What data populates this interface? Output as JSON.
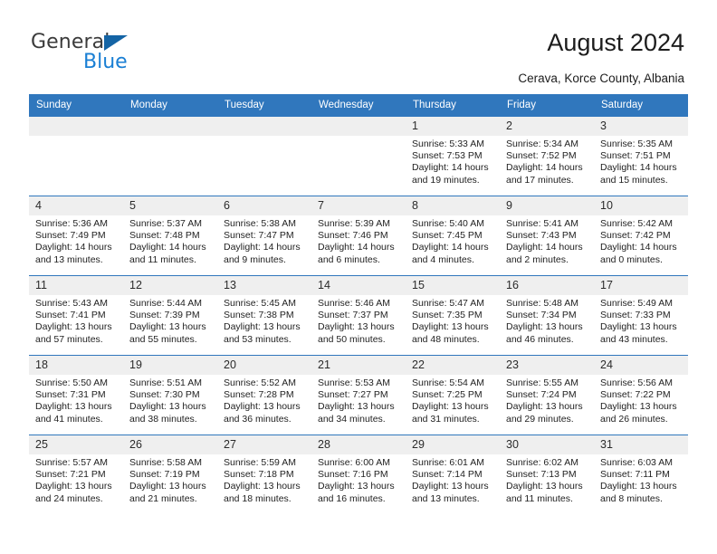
{
  "brand": {
    "name_primary": "General",
    "name_secondary": "Blue",
    "triangle_color": "#1464a5",
    "blue_color": "#1a7fd4"
  },
  "header": {
    "title": "August 2024",
    "subtitle": "Cerava, Korce County, Albania"
  },
  "theme": {
    "header_row_bg": "#3077bd",
    "daynum_bg": "#efefef",
    "row_border": "#3077bd"
  },
  "weekday_headers": [
    "Sunday",
    "Monday",
    "Tuesday",
    "Wednesday",
    "Thursday",
    "Friday",
    "Saturday"
  ],
  "weeks": [
    [
      {
        "day": "",
        "sunrise": "",
        "sunset": "",
        "daylight_line1": "",
        "daylight_line2": ""
      },
      {
        "day": "",
        "sunrise": "",
        "sunset": "",
        "daylight_line1": "",
        "daylight_line2": ""
      },
      {
        "day": "",
        "sunrise": "",
        "sunset": "",
        "daylight_line1": "",
        "daylight_line2": ""
      },
      {
        "day": "",
        "sunrise": "",
        "sunset": "",
        "daylight_line1": "",
        "daylight_line2": ""
      },
      {
        "day": "1",
        "sunrise": "Sunrise: 5:33 AM",
        "sunset": "Sunset: 7:53 PM",
        "daylight_line1": "Daylight: 14 hours",
        "daylight_line2": "and 19 minutes."
      },
      {
        "day": "2",
        "sunrise": "Sunrise: 5:34 AM",
        "sunset": "Sunset: 7:52 PM",
        "daylight_line1": "Daylight: 14 hours",
        "daylight_line2": "and 17 minutes."
      },
      {
        "day": "3",
        "sunrise": "Sunrise: 5:35 AM",
        "sunset": "Sunset: 7:51 PM",
        "daylight_line1": "Daylight: 14 hours",
        "daylight_line2": "and 15 minutes."
      }
    ],
    [
      {
        "day": "4",
        "sunrise": "Sunrise: 5:36 AM",
        "sunset": "Sunset: 7:49 PM",
        "daylight_line1": "Daylight: 14 hours",
        "daylight_line2": "and 13 minutes."
      },
      {
        "day": "5",
        "sunrise": "Sunrise: 5:37 AM",
        "sunset": "Sunset: 7:48 PM",
        "daylight_line1": "Daylight: 14 hours",
        "daylight_line2": "and 11 minutes."
      },
      {
        "day": "6",
        "sunrise": "Sunrise: 5:38 AM",
        "sunset": "Sunset: 7:47 PM",
        "daylight_line1": "Daylight: 14 hours",
        "daylight_line2": "and 9 minutes."
      },
      {
        "day": "7",
        "sunrise": "Sunrise: 5:39 AM",
        "sunset": "Sunset: 7:46 PM",
        "daylight_line1": "Daylight: 14 hours",
        "daylight_line2": "and 6 minutes."
      },
      {
        "day": "8",
        "sunrise": "Sunrise: 5:40 AM",
        "sunset": "Sunset: 7:45 PM",
        "daylight_line1": "Daylight: 14 hours",
        "daylight_line2": "and 4 minutes."
      },
      {
        "day": "9",
        "sunrise": "Sunrise: 5:41 AM",
        "sunset": "Sunset: 7:43 PM",
        "daylight_line1": "Daylight: 14 hours",
        "daylight_line2": "and 2 minutes."
      },
      {
        "day": "10",
        "sunrise": "Sunrise: 5:42 AM",
        "sunset": "Sunset: 7:42 PM",
        "daylight_line1": "Daylight: 14 hours",
        "daylight_line2": "and 0 minutes."
      }
    ],
    [
      {
        "day": "11",
        "sunrise": "Sunrise: 5:43 AM",
        "sunset": "Sunset: 7:41 PM",
        "daylight_line1": "Daylight: 13 hours",
        "daylight_line2": "and 57 minutes."
      },
      {
        "day": "12",
        "sunrise": "Sunrise: 5:44 AM",
        "sunset": "Sunset: 7:39 PM",
        "daylight_line1": "Daylight: 13 hours",
        "daylight_line2": "and 55 minutes."
      },
      {
        "day": "13",
        "sunrise": "Sunrise: 5:45 AM",
        "sunset": "Sunset: 7:38 PM",
        "daylight_line1": "Daylight: 13 hours",
        "daylight_line2": "and 53 minutes."
      },
      {
        "day": "14",
        "sunrise": "Sunrise: 5:46 AM",
        "sunset": "Sunset: 7:37 PM",
        "daylight_line1": "Daylight: 13 hours",
        "daylight_line2": "and 50 minutes."
      },
      {
        "day": "15",
        "sunrise": "Sunrise: 5:47 AM",
        "sunset": "Sunset: 7:35 PM",
        "daylight_line1": "Daylight: 13 hours",
        "daylight_line2": "and 48 minutes."
      },
      {
        "day": "16",
        "sunrise": "Sunrise: 5:48 AM",
        "sunset": "Sunset: 7:34 PM",
        "daylight_line1": "Daylight: 13 hours",
        "daylight_line2": "and 46 minutes."
      },
      {
        "day": "17",
        "sunrise": "Sunrise: 5:49 AM",
        "sunset": "Sunset: 7:33 PM",
        "daylight_line1": "Daylight: 13 hours",
        "daylight_line2": "and 43 minutes."
      }
    ],
    [
      {
        "day": "18",
        "sunrise": "Sunrise: 5:50 AM",
        "sunset": "Sunset: 7:31 PM",
        "daylight_line1": "Daylight: 13 hours",
        "daylight_line2": "and 41 minutes."
      },
      {
        "day": "19",
        "sunrise": "Sunrise: 5:51 AM",
        "sunset": "Sunset: 7:30 PM",
        "daylight_line1": "Daylight: 13 hours",
        "daylight_line2": "and 38 minutes."
      },
      {
        "day": "20",
        "sunrise": "Sunrise: 5:52 AM",
        "sunset": "Sunset: 7:28 PM",
        "daylight_line1": "Daylight: 13 hours",
        "daylight_line2": "and 36 minutes."
      },
      {
        "day": "21",
        "sunrise": "Sunrise: 5:53 AM",
        "sunset": "Sunset: 7:27 PM",
        "daylight_line1": "Daylight: 13 hours",
        "daylight_line2": "and 34 minutes."
      },
      {
        "day": "22",
        "sunrise": "Sunrise: 5:54 AM",
        "sunset": "Sunset: 7:25 PM",
        "daylight_line1": "Daylight: 13 hours",
        "daylight_line2": "and 31 minutes."
      },
      {
        "day": "23",
        "sunrise": "Sunrise: 5:55 AM",
        "sunset": "Sunset: 7:24 PM",
        "daylight_line1": "Daylight: 13 hours",
        "daylight_line2": "and 29 minutes."
      },
      {
        "day": "24",
        "sunrise": "Sunrise: 5:56 AM",
        "sunset": "Sunset: 7:22 PM",
        "daylight_line1": "Daylight: 13 hours",
        "daylight_line2": "and 26 minutes."
      }
    ],
    [
      {
        "day": "25",
        "sunrise": "Sunrise: 5:57 AM",
        "sunset": "Sunset: 7:21 PM",
        "daylight_line1": "Daylight: 13 hours",
        "daylight_line2": "and 24 minutes."
      },
      {
        "day": "26",
        "sunrise": "Sunrise: 5:58 AM",
        "sunset": "Sunset: 7:19 PM",
        "daylight_line1": "Daylight: 13 hours",
        "daylight_line2": "and 21 minutes."
      },
      {
        "day": "27",
        "sunrise": "Sunrise: 5:59 AM",
        "sunset": "Sunset: 7:18 PM",
        "daylight_line1": "Daylight: 13 hours",
        "daylight_line2": "and 18 minutes."
      },
      {
        "day": "28",
        "sunrise": "Sunrise: 6:00 AM",
        "sunset": "Sunset: 7:16 PM",
        "daylight_line1": "Daylight: 13 hours",
        "daylight_line2": "and 16 minutes."
      },
      {
        "day": "29",
        "sunrise": "Sunrise: 6:01 AM",
        "sunset": "Sunset: 7:14 PM",
        "daylight_line1": "Daylight: 13 hours",
        "daylight_line2": "and 13 minutes."
      },
      {
        "day": "30",
        "sunrise": "Sunrise: 6:02 AM",
        "sunset": "Sunset: 7:13 PM",
        "daylight_line1": "Daylight: 13 hours",
        "daylight_line2": "and 11 minutes."
      },
      {
        "day": "31",
        "sunrise": "Sunrise: 6:03 AM",
        "sunset": "Sunset: 7:11 PM",
        "daylight_line1": "Daylight: 13 hours",
        "daylight_line2": "and 8 minutes."
      }
    ]
  ]
}
